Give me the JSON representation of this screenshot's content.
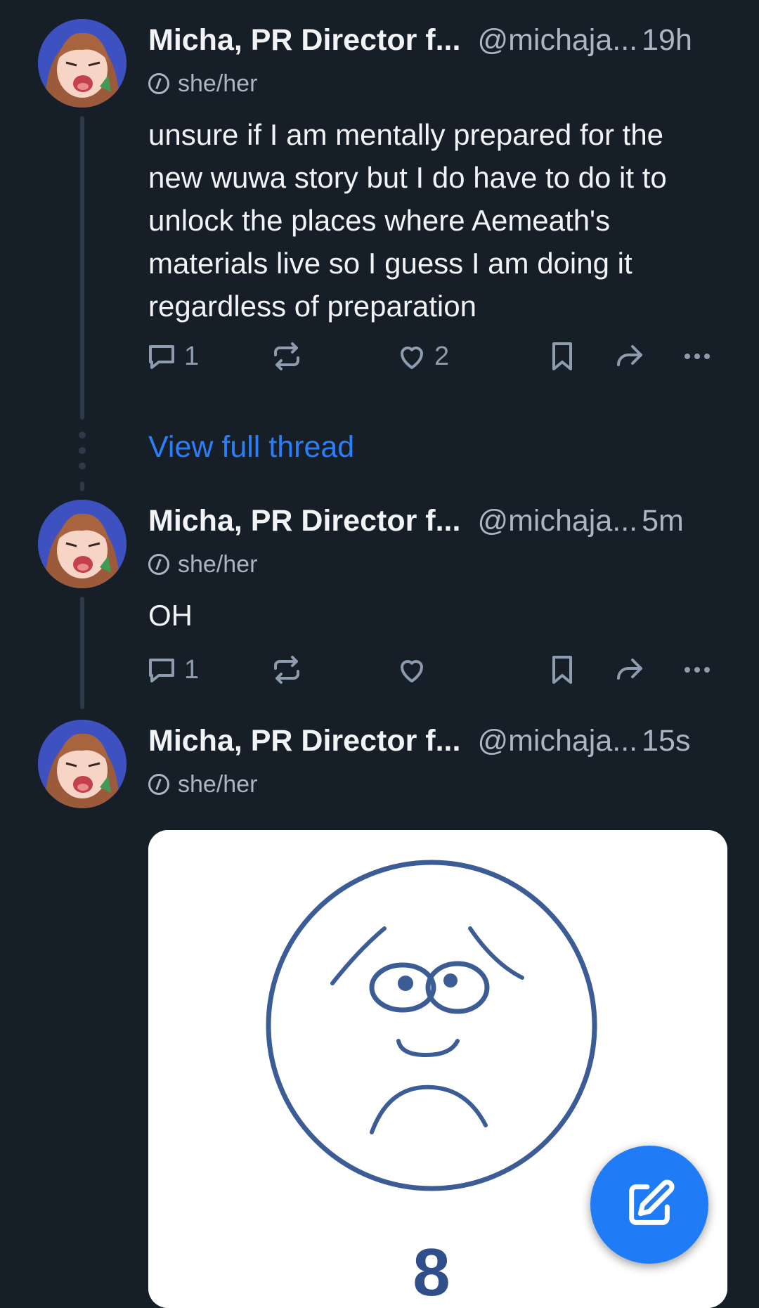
{
  "posts": [
    {
      "display_name": "Micha, PR Director f...",
      "handle": "@michaja...",
      "time": "19h",
      "pronouns": "she/her",
      "text": "unsure if I am mentally prepared for the new wuwa story but I do have to do it to unlock the places where Aemeath's materials live so I guess I am doing it regardless of preparation",
      "reply_count": "1",
      "like_count": "2"
    },
    {
      "display_name": "Micha, PR Director f...",
      "handle": "@michaja...",
      "time": "5m",
      "pronouns": "she/her",
      "text": "OH",
      "reply_count": "1",
      "like_count": ""
    },
    {
      "display_name": "Micha, PR Director f...",
      "handle": "@michaja...",
      "time": "15s",
      "pronouns": "she/her",
      "image_caption_digit": "8"
    }
  ],
  "view_thread_label": "View full thread",
  "icons": {
    "reply": "reply-icon",
    "repost": "repost-icon",
    "like": "heart-icon",
    "bookmark": "bookmark-icon",
    "share": "share-icon",
    "more": "more-icon",
    "compose": "compose-icon"
  },
  "colors": {
    "background": "#161e27",
    "accent": "#1f7cf6",
    "link": "#2c7ef8",
    "muted": "#aab6c4"
  }
}
